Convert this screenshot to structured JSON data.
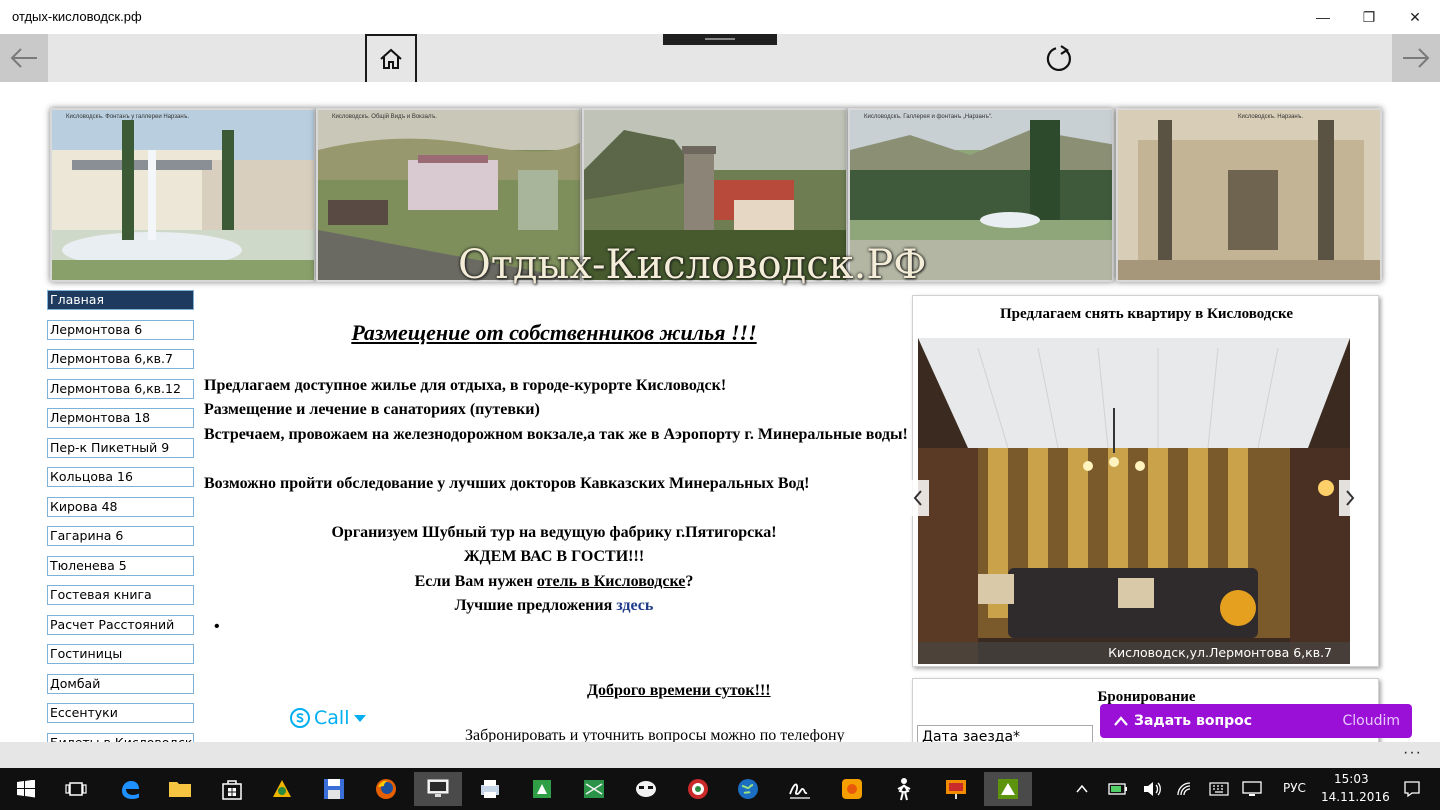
{
  "window": {
    "title": "отдых-кисловодск.рф",
    "minimize": "—",
    "restore": "❐",
    "close": "✕"
  },
  "banner": {
    "title": "Отдых-Кисловодск.РФ",
    "captions": [
      "Кисловодскъ.   Фонтанъ у галлереи Нарзанъ.",
      "Кисловодскъ. Общiй Видъ и Вокзалъ.",
      "",
      "Кисловодскъ.   Галлерея и фонтанъ „Нарзанъ“.",
      "Кисловодскъ. Нарзанъ."
    ]
  },
  "menu": [
    "Главная",
    "Лермонтова 6",
    "Лермонтова 6,кв.7",
    "Лермонтова 6,кв.12",
    "Лермонтова 18",
    "Пер-к Пикетный 9",
    "Кольцова 16",
    "Кирова 48",
    "Гагарина 6",
    "Тюленева 5",
    "Гостевая книга",
    "Расчет Расстояний",
    "Гостиницы",
    "Домбай",
    "Ессентуки",
    "Билеты в Кисловодск"
  ],
  "content": {
    "heading": "Размещение от собственников жилья !!!",
    "p1": "Предлагаем доступное жилье для отдыха, в городе-курорте Кисловодск!",
    "p2": "Размещение и лечение в санаториях (путевки)",
    "p3": "Встречаем, провожаем на железнодорожном вокзале,а так же в Аэропорту г. Минеральные воды!",
    "p4": "Возможно пройти обследование у лучших докторов Кавказских Минеральных Вод!",
    "c1": "Организуем Шубный тур на ведущую фабрику г.Пятигорска!",
    "c2": "ЖДЕМ ВАС В ГОСТИ!!!",
    "c3_pre": "Если Вам нужен ",
    "c3_link": "отель в Кисловодске",
    "c3_post": "?",
    "c4_pre": "Лучшие предложения ",
    "c4_link": "здесь",
    "bullet": "•",
    "skype": "Call",
    "greeting": "Доброго времени суток!!!",
    "phone_line": "Забронировать и уточнить вопросы можно по телефону"
  },
  "widget": {
    "title": "Предлагаем снять квартиру в Кисловодске",
    "caption": "Кисловодск,ул.Лермонтова 6,кв.7"
  },
  "booking": {
    "title": "Бронирование",
    "date_placeholder": "Дата заезда*"
  },
  "chat": {
    "label": "Задать вопрос",
    "brand": "Cloudim"
  },
  "appbar": {
    "more": "···"
  },
  "taskbar": {
    "lang": "РУС",
    "time": "15:03",
    "date": "14.11.2016",
    "icons": [
      "windows-start-icon",
      "task-view-icon",
      "edge-icon",
      "file-explorer-icon",
      "store-icon",
      "app-icon",
      "save-icon",
      "firefox-icon",
      "monitor-icon",
      "printer-icon",
      "tool-icon",
      "map-icon",
      "mask-icon",
      "target-icon",
      "globe-icon",
      "signature-icon",
      "sun-icon",
      "person-icon",
      "presentation-icon",
      "browser-app-icon"
    ]
  },
  "colors": {
    "menu_active_bg": "#1f3a5f",
    "menu_border": "#7fb0d6",
    "chat_purple": "#9b10d6",
    "link_blue": "#1f3a8a",
    "skype_blue": "#00aff0"
  }
}
